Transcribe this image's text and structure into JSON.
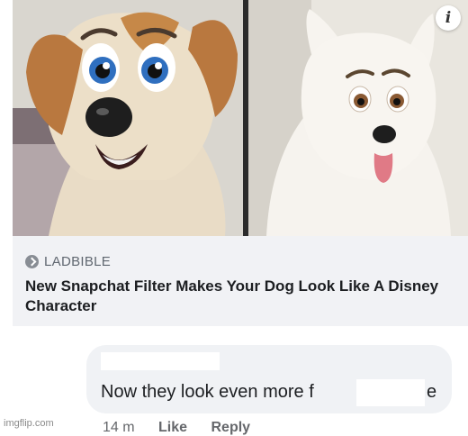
{
  "post_image": {
    "left_photo_icon": "cartoon-dog-face-icon",
    "right_photo_icon": "cartoon-dog-face-icon",
    "info_icon": "info-icon",
    "info_glyph": "i"
  },
  "link_preview": {
    "source_icon": "source-arrow-icon",
    "source_name": "LADBIBLE",
    "headline": "New Snapchat Filter Makes Your Dog Look Like A Disney Character"
  },
  "comment": {
    "text": "Now they look even more f",
    "text_tail": "e",
    "time": "14 m",
    "like_label": "Like",
    "reply_label": "Reply"
  },
  "watermark": "imgflip.com",
  "colors": {
    "card_background": "#f1f2f5",
    "bubble_background": "#f0f2f5",
    "headline_text": "#1c1e21",
    "meta_text": "#65676b"
  }
}
